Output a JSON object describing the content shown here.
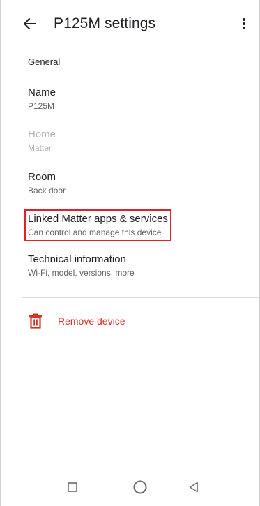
{
  "header": {
    "title": "P125M settings",
    "back_icon": "arrow-back-icon",
    "more_icon": "more-vert-icon"
  },
  "section": {
    "label": "General"
  },
  "settings": [
    {
      "title": "Name",
      "subtitle": "P125M",
      "enabled": true
    },
    {
      "title": "Home",
      "subtitle": "Matter",
      "enabled": false
    },
    {
      "title": "Room",
      "subtitle": "Back door",
      "enabled": true
    },
    {
      "title": "Linked Matter apps & services",
      "subtitle": "Can control and manage this device",
      "enabled": true,
      "highlighted": true
    },
    {
      "title": "Technical information",
      "subtitle": "Wi-Fi, model, versions, more",
      "enabled": true
    }
  ],
  "remove": {
    "label": "Remove device",
    "icon": "trash-icon",
    "color": "#d93025"
  },
  "navbar": {
    "recent_icon": "recents-square-icon",
    "home_icon": "home-circle-icon",
    "back_icon": "back-triangle-icon"
  },
  "colors": {
    "highlight_border": "#e0202a",
    "danger": "#d93025"
  }
}
